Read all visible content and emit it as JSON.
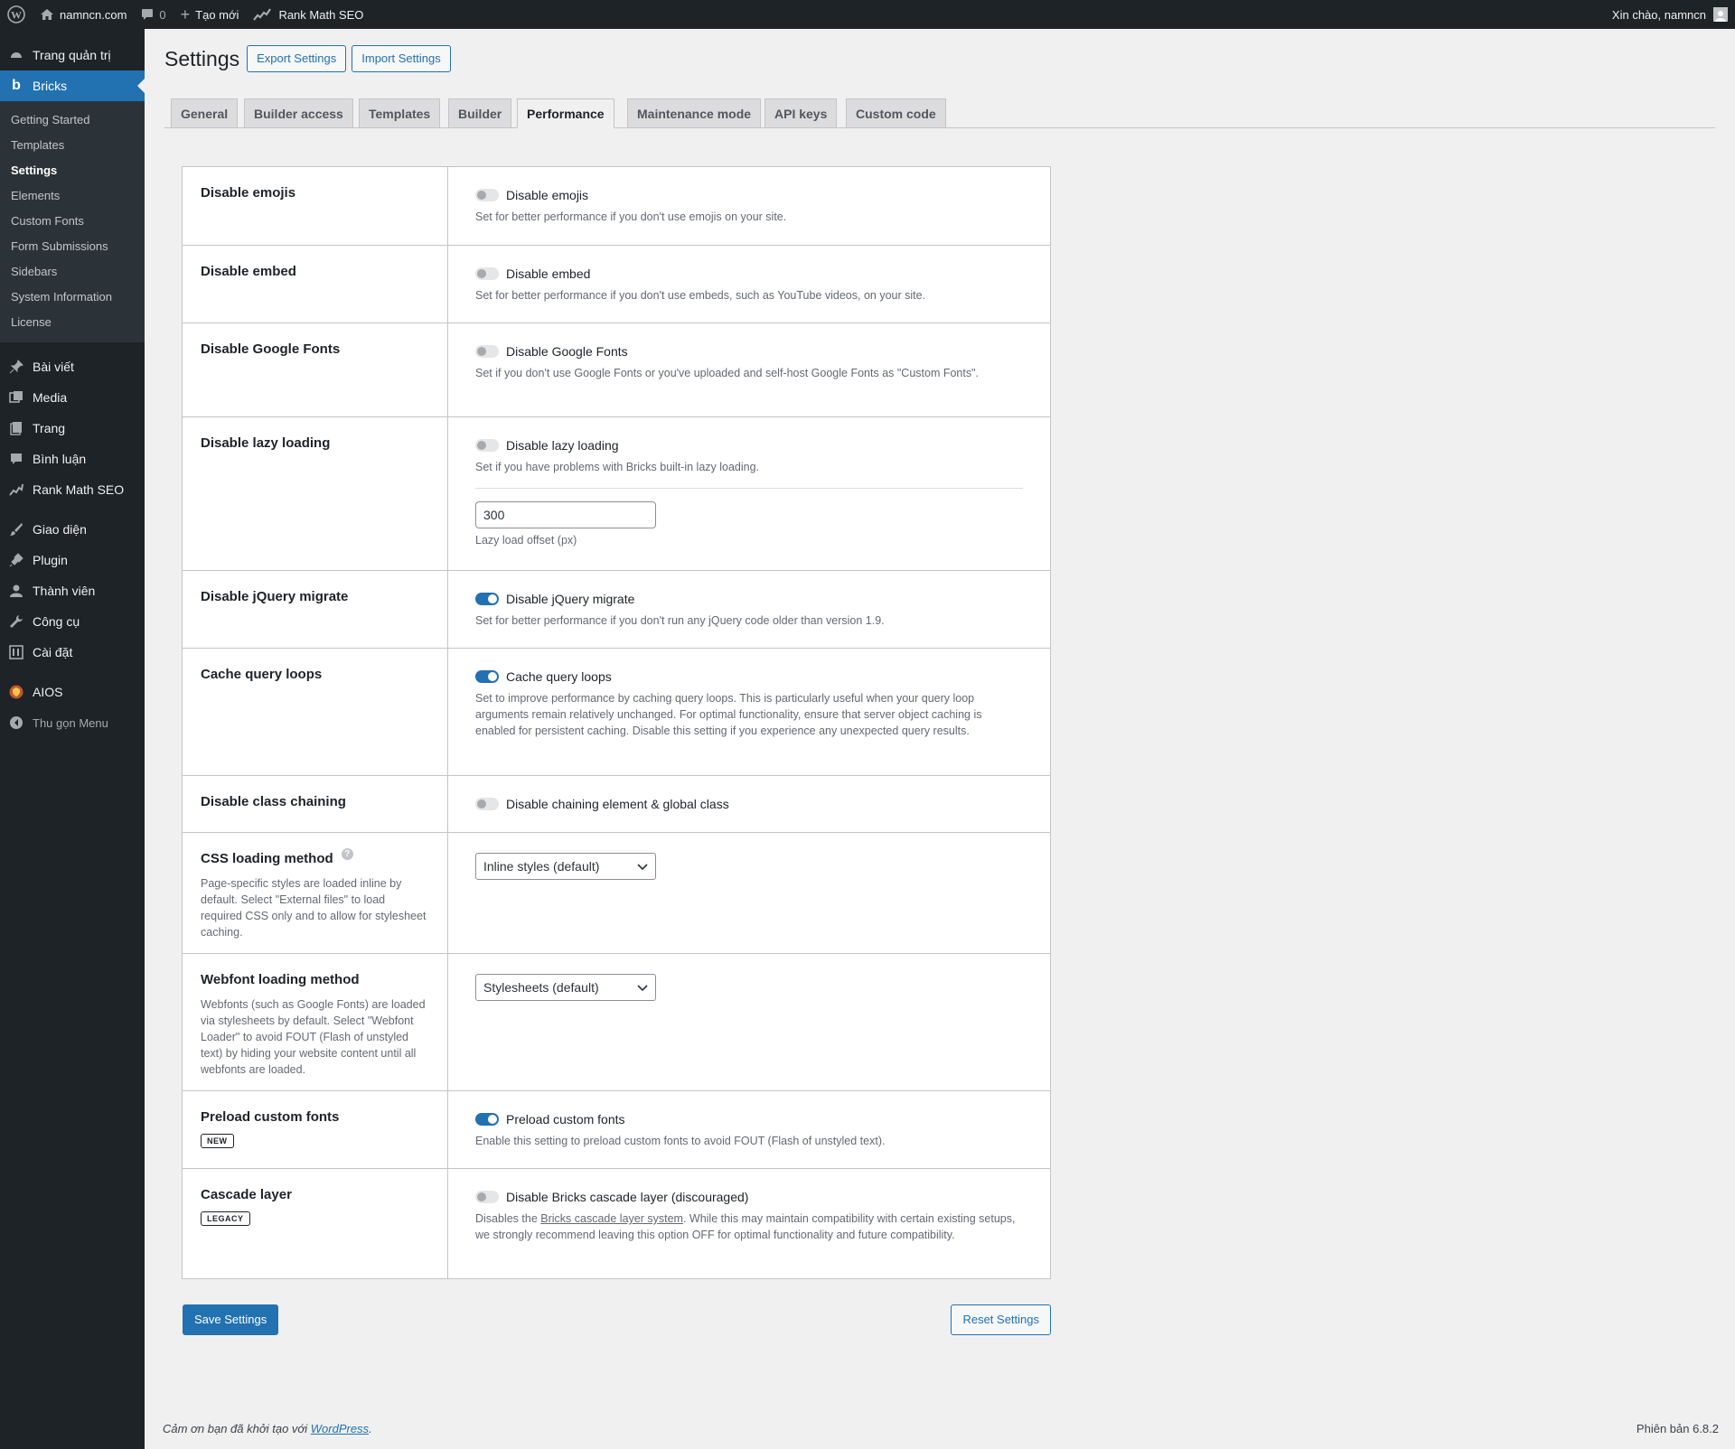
{
  "adminbar": {
    "site_name": "namncn.com",
    "comments_count": "0",
    "new_label": "Tạo mới",
    "seo_label": "Rank Math SEO",
    "greeting": "Xin chào, namncn"
  },
  "sidebar": {
    "dashboard": "Trang quản trị",
    "bricks": "Bricks",
    "bricks_sub": [
      "Getting Started",
      "Templates",
      "Settings",
      "Elements",
      "Custom Fonts",
      "Form Submissions",
      "Sidebars",
      "System Information",
      "License"
    ],
    "posts": "Bài viết",
    "media": "Media",
    "pages": "Trang",
    "comments": "Bình luận",
    "rankmath": "Rank Math SEO",
    "appearance": "Giao diện",
    "plugins": "Plugin",
    "users": "Thành viên",
    "tools": "Công cụ",
    "settings": "Cài đặt",
    "aios": "AIOS",
    "collapse": "Thu gọn Menu"
  },
  "header": {
    "title": "Settings",
    "export": "Export Settings",
    "import": "Import Settings"
  },
  "tabs": [
    "General",
    "Builder access",
    "Templates",
    "Builder",
    "Performance",
    "Maintenance mode",
    "API keys",
    "Custom code"
  ],
  "rows": {
    "emojis": {
      "label": "Disable emojis",
      "option": "Disable emojis",
      "desc": "Set for better performance if you don't use emojis on your site.",
      "on": false
    },
    "embed": {
      "label": "Disable embed",
      "option": "Disable embed",
      "desc": "Set for better performance if you don't use embeds, such as YouTube videos, on your site.",
      "on": false
    },
    "gfonts": {
      "label": "Disable Google Fonts",
      "option": "Disable Google Fonts",
      "desc": "Set if you don't use Google Fonts or you've uploaded and self-host Google Fonts as \"Custom Fonts\".",
      "on": false
    },
    "lazy": {
      "label": "Disable lazy loading",
      "option": "Disable lazy loading",
      "desc": "Set if you have problems with Bricks built-in lazy loading.",
      "offset_value": "300",
      "offset_hint": "Lazy load offset (px)",
      "on": false
    },
    "jquery": {
      "label": "Disable jQuery migrate",
      "option": "Disable jQuery migrate",
      "desc": "Set for better performance if you don't run any jQuery code older than version 1.9.",
      "on": true
    },
    "cache": {
      "label": "Cache query loops",
      "option": "Cache query loops",
      "desc": "Set to improve performance by caching query loops. This is particularly useful when your query loop arguments remain relatively unchanged. For optimal functionality, ensure that server object caching is enabled for persistent caching. Disable this setting if you experience any unexpected query results.",
      "on": true
    },
    "chaining": {
      "label": "Disable class chaining",
      "option": "Disable chaining element & global class",
      "on": false
    },
    "css": {
      "label": "CSS loading method",
      "help": "?",
      "desc": "Page-specific styles are loaded inline by default. Select \"External files\" to load required CSS only and to allow for stylesheet caching.",
      "selected": "Inline styles (default)"
    },
    "webfont": {
      "label": "Webfont loading method",
      "desc": "Webfonts (such as Google Fonts) are loaded via stylesheets by default. Select \"Webfont Loader\" to avoid FOUT (Flash of unstyled text) by hiding your website content until all webfonts are loaded.",
      "selected": "Stylesheets (default)"
    },
    "preload": {
      "label": "Preload custom fonts",
      "badge": "NEW",
      "option": "Preload custom fonts",
      "desc": "Enable this setting to preload custom fonts to avoid FOUT (Flash of unstyled text).",
      "on": true
    },
    "cascade": {
      "label": "Cascade layer",
      "badge": "LEGACY",
      "option": "Disable Bricks cascade layer (discouraged)",
      "desc_pre": "Disables the ",
      "desc_link": "Bricks cascade layer system",
      "desc_post": ". While this may maintain compatibility with certain existing setups, we strongly recommend leaving this option OFF for optimal functionality and future compatibility.",
      "on": false
    }
  },
  "buttons": {
    "save": "Save Settings",
    "reset": "Reset Settings"
  },
  "footer": {
    "thanks_pre": "Cảm ơn bạn đã khởi tạo với ",
    "thanks_link": "WordPress",
    "thanks_post": ".",
    "version": "Phiên bản 6.8.2"
  },
  "colors": {
    "accent": "#2271b1",
    "admin_dark": "#1d2327",
    "submenu_bg": "#2c3338"
  }
}
